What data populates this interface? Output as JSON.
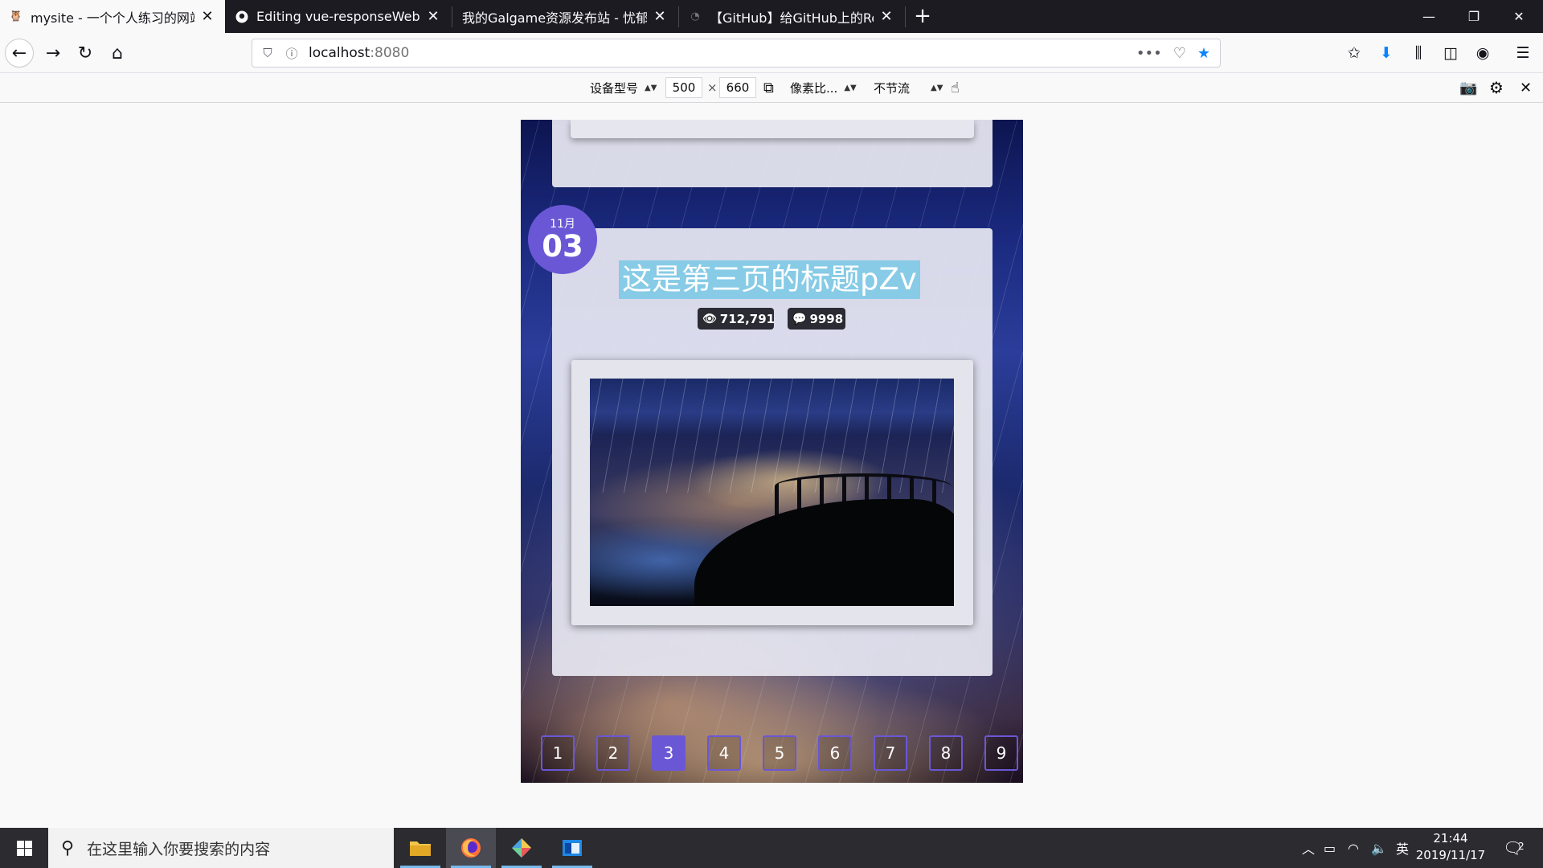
{
  "browser": {
    "tabs": [
      {
        "title": "mysite - 一个个人练习的网站",
        "active": true,
        "favicon": "owl-icon"
      },
      {
        "title": "Editing vue-responseWebPa",
        "active": false,
        "favicon": "github-icon"
      },
      {
        "title": "我的Galgame资源发布站 - 忧郁的",
        "active": false,
        "favicon": "none"
      },
      {
        "title": "【GitHub】给GitHub上的Rea",
        "active": false,
        "favicon": "github-loading-icon"
      }
    ],
    "url_host": "localhost",
    "url_port": ":8080"
  },
  "rdm": {
    "device": "设备型号",
    "width": "500",
    "times": "×",
    "height": "660",
    "dpr": "像素比...",
    "throttle": "不节流"
  },
  "page": {
    "date_month": "11月",
    "date_day": "03",
    "title": "这是第三页的标题pZv",
    "views": "712,791",
    "comments": "9998",
    "pages": [
      "1",
      "2",
      "3",
      "4",
      "5",
      "6",
      "7",
      "8",
      "9"
    ],
    "current_page": "3"
  },
  "taskbar": {
    "search_placeholder": "在这里输入你要搜索的内容",
    "ime": "英",
    "time": "21:44",
    "date": "2019/11/17",
    "notifications": "2"
  },
  "colors": {
    "accent": "#6a57d6",
    "title_highlight": "#87cbe6",
    "tab_bar": "#1c1b22",
    "bookmark_star": "#0a84ff"
  }
}
